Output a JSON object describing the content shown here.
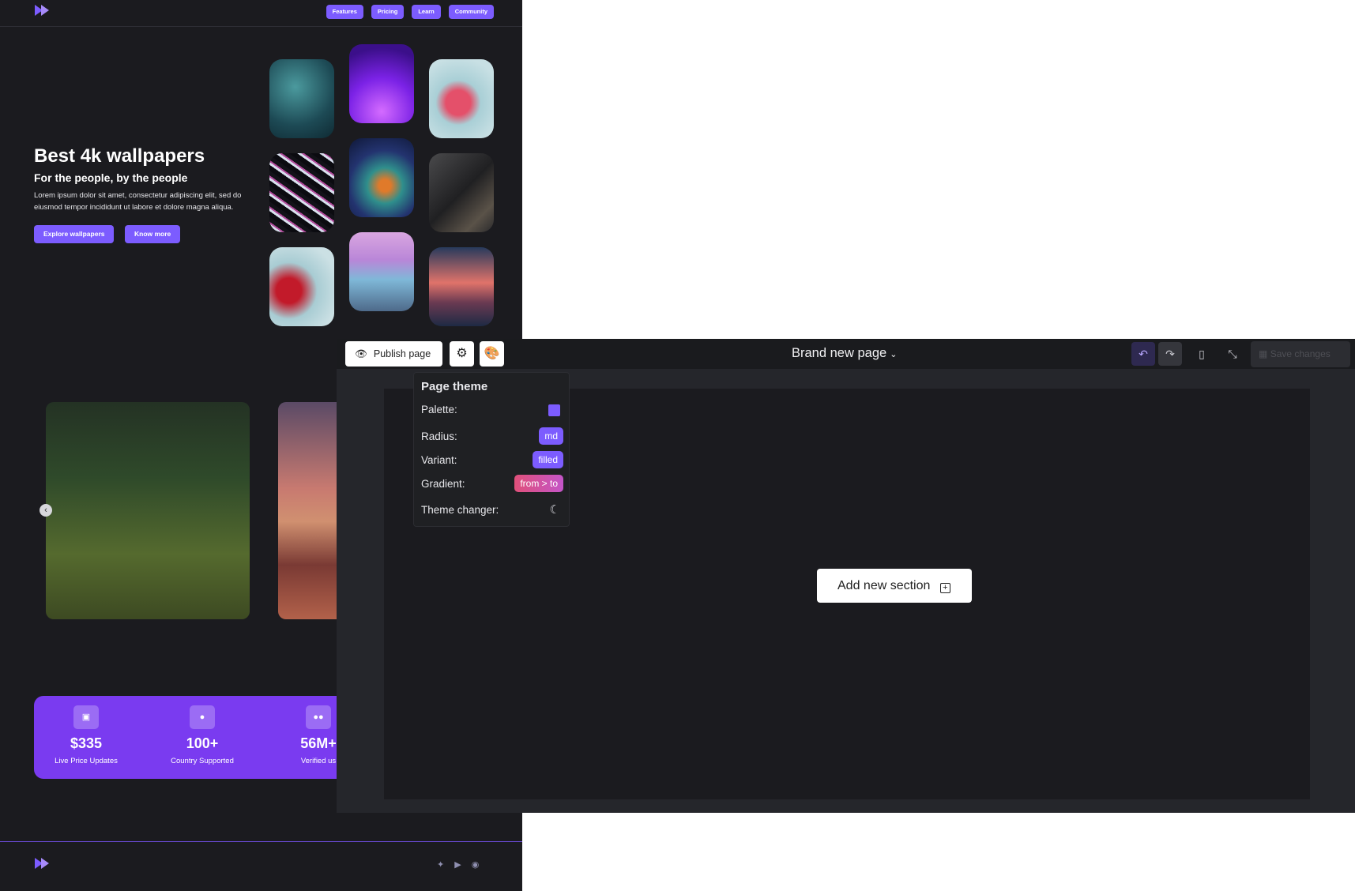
{
  "site": {
    "nav": [
      "Features",
      "Pricing",
      "Learn",
      "Community"
    ],
    "hero": {
      "title": "Best 4k wallpapers",
      "subtitle": "For the people, by the people",
      "description": "Lorem ipsum dolor sit amet, consectetur adipiscing elit, sed do eiusmod tempor incididunt ut labore et dolore magna aliqua.",
      "primary_button": "Explore wallpapers",
      "secondary_button": "Know more"
    },
    "stats": [
      {
        "icon": "ticket-icon",
        "value": "$335",
        "label": "Live Price Updates"
      },
      {
        "icon": "globe-icon",
        "value": "100+",
        "label": "Country Supported"
      },
      {
        "icon": "users-icon",
        "value": "56M+",
        "label": "Verified us"
      }
    ],
    "socials": [
      "twitter-icon",
      "youtube-icon",
      "instagram-icon"
    ]
  },
  "editor": {
    "publish_label": "Publish page",
    "page_title": "Brand new page",
    "save_label": "Save changes",
    "add_section_label": "Add new section",
    "theme_panel": {
      "title": "Page theme",
      "palette_label": "Palette:",
      "palette_color": "#7c5cff",
      "radius_label": "Radius:",
      "radius_value": "md",
      "variant_label": "Variant:",
      "variant_value": "filled",
      "gradient_label": "Gradient:",
      "gradient_value": "from > to",
      "theme_changer_label": "Theme changer:"
    }
  }
}
